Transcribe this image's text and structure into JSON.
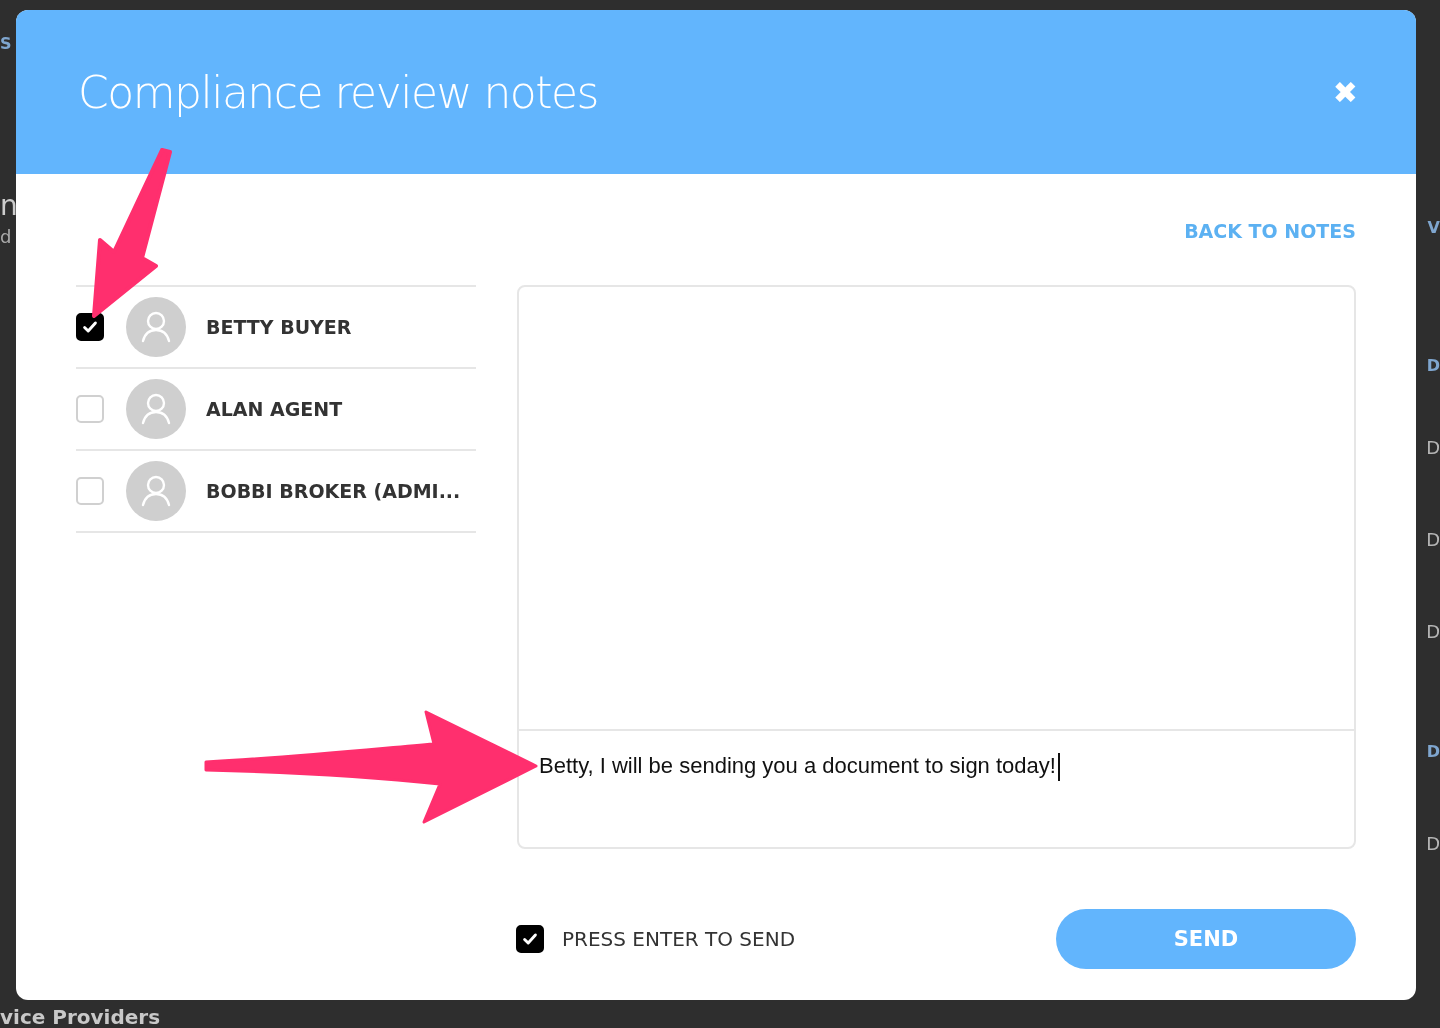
{
  "background": {
    "left_fragments": [
      {
        "kind": "link",
        "text": "S"
      },
      {
        "kind": "heading",
        "text": "n"
      },
      {
        "kind": "caption",
        "text": "d"
      }
    ],
    "right_fragments": [
      {
        "kind": "link",
        "text": "V"
      },
      {
        "kind": "link",
        "text": "D"
      },
      {
        "kind": "cell",
        "text": "D"
      },
      {
        "kind": "cell",
        "text": "D"
      },
      {
        "kind": "cell",
        "text": "D"
      },
      {
        "kind": "link",
        "text": "D"
      },
      {
        "kind": "cell",
        "text": "D"
      }
    ],
    "bottom_heading": "vice Providers"
  },
  "dialog": {
    "title": "Compliance review notes",
    "close": "✖",
    "back_link": "BACK TO NOTES",
    "recipients": [
      {
        "name": "BETTY BUYER",
        "checked": true
      },
      {
        "name": "ALAN AGENT",
        "checked": false
      },
      {
        "name": "BOBBI BROKER (ADMI...",
        "checked": false
      }
    ],
    "message": {
      "value": "Betty, I will be sending you a document to sign today!"
    },
    "enter_to_send": {
      "label": "PRESS ENTER TO SEND",
      "checked": true
    },
    "send_button": "SEND"
  }
}
